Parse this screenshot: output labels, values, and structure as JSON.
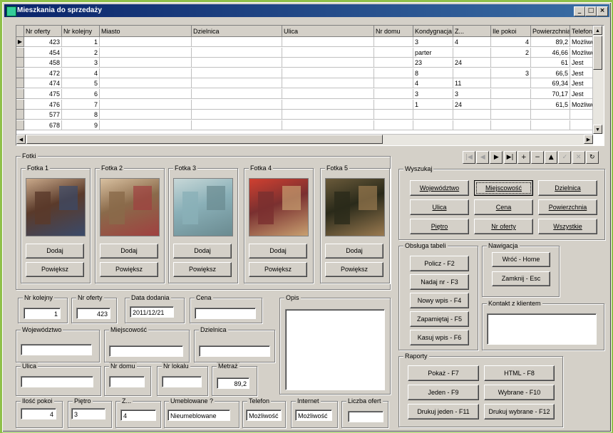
{
  "window": {
    "title": "Mieszkania do sprzedaży",
    "controls": [
      "_",
      "□",
      "×"
    ]
  },
  "grid": {
    "columns": [
      "Nr oferty",
      "Nr kolejny",
      "Miasto",
      "Dzielnica",
      "Ulica",
      "Nr domu",
      "Kondygnacja",
      "Z...",
      "Ile pokoi",
      "Powierzchnia",
      "Telefon"
    ],
    "rows": [
      [
        "423",
        "1",
        "",
        "",
        "",
        "",
        "3",
        "4",
        "4",
        "89,2",
        "Możliwo"
      ],
      [
        "454",
        "2",
        "",
        "",
        "",
        "",
        "parter",
        "",
        "2",
        "46,66",
        "Możliwo"
      ],
      [
        "458",
        "3",
        "",
        "",
        "",
        "",
        "23",
        "24",
        "",
        "61",
        "Jest"
      ],
      [
        "472",
        "4",
        "",
        "",
        "",
        "",
        "8",
        "",
        "3",
        "66,5",
        "Jest"
      ],
      [
        "474",
        "5",
        "",
        "",
        "",
        "",
        "4",
        "11",
        "",
        "69,34",
        "Jest"
      ],
      [
        "475",
        "6",
        "",
        "",
        "",
        "",
        "3",
        "3",
        "",
        "70,17",
        "Jest"
      ],
      [
        "476",
        "7",
        "",
        "",
        "",
        "",
        "1",
        "24",
        "",
        "61,5",
        "Możliwo"
      ],
      [
        "577",
        "8",
        "",
        "",
        "",
        "",
        "",
        "",
        "",
        "",
        ""
      ],
      [
        "678",
        "9",
        "",
        "",
        "",
        "",
        "",
        "",
        "",
        "",
        ""
      ]
    ]
  },
  "navigator": {
    "buttons": [
      "|◀",
      "◀",
      "▶",
      "▶|",
      "+",
      "−",
      "▲",
      "✓",
      "✕",
      "↻"
    ]
  },
  "fotki": {
    "title": "Fotki",
    "items": [
      {
        "label": "Fotka 1",
        "add": "Dodaj",
        "zoom": "Powiększ"
      },
      {
        "label": "Fotka 2",
        "add": "Dodaj",
        "zoom": "Powiększ"
      },
      {
        "label": "Fotka 3",
        "add": "Dodaj",
        "zoom": "Powiększ"
      },
      {
        "label": "Fotka 4",
        "add": "Dodaj",
        "zoom": "Powiększ"
      },
      {
        "label": "Fotka 5",
        "add": "Dodaj",
        "zoom": "Powiększ"
      }
    ]
  },
  "wyszukaj": {
    "title": "Wyszukaj",
    "buttons": [
      "Województwo",
      "Miejscowość",
      "Dzielnica",
      "Ulica",
      "Cena",
      "Powierzchnia",
      "Piętro",
      "Nr oferty",
      "Wszystkie"
    ]
  },
  "obsluga": {
    "title": "Obsługa tabeli",
    "buttons": [
      "Policz - F2",
      "Nadaj nr - F3",
      "Nowy wpis - F4",
      "Zapamiętaj - F5",
      "Kasuj wpis - F6"
    ]
  },
  "nawigacja": {
    "title": "Nawigacja",
    "buttons": [
      "Wróć - Home",
      "Zamknij - Esc"
    ]
  },
  "kontakt": {
    "title": "Kontakt z klientem"
  },
  "raporty": {
    "title": "Raporty",
    "buttons": [
      "Pokaż - F7",
      "HTML - F8",
      "Jeden - F9",
      "Wybrane - F10",
      "Drukuj  jeden - F11",
      "Drukuj wybrane - F12"
    ]
  },
  "fields": {
    "nr_kolejny": {
      "label": "Nr kolejny",
      "value": "1"
    },
    "nr_oferty": {
      "label": "Nr oferty",
      "value": "423"
    },
    "data_dodania": {
      "label": "Data dodania",
      "value": "2011/12/21"
    },
    "cena": {
      "label": "Cena",
      "value": ""
    },
    "opis": {
      "label": "Opis"
    },
    "wojewodztwo": {
      "label": "Województwo",
      "value": ""
    },
    "miejscowosc": {
      "label": "Miejscowość",
      "value": ""
    },
    "dzielnica": {
      "label": "Dzielnica",
      "value": ""
    },
    "ulica": {
      "label": "Ulica",
      "value": ""
    },
    "nr_domu": {
      "label": "Nr domu",
      "value": ""
    },
    "nr_lokalu": {
      "label": "Nr lokalu",
      "value": ""
    },
    "metraz": {
      "label": "Metraż",
      "value": "89,2"
    },
    "ilosc_pokoi": {
      "label": "Ilość pokoi",
      "value": "4"
    },
    "pietro": {
      "label": "Piętro",
      "value": "3"
    },
    "z": {
      "label": "Z...",
      "value": "4"
    },
    "umeblowane": {
      "label": "Umeblowane ?",
      "value": "Nieumeblowane"
    },
    "telefon": {
      "label": "Telefon",
      "value": "Możliwość"
    },
    "internet": {
      "label": "Internet",
      "value": "Możliwość"
    },
    "liczba_ofert": {
      "label": "Liczba ofert",
      "value": ""
    }
  }
}
